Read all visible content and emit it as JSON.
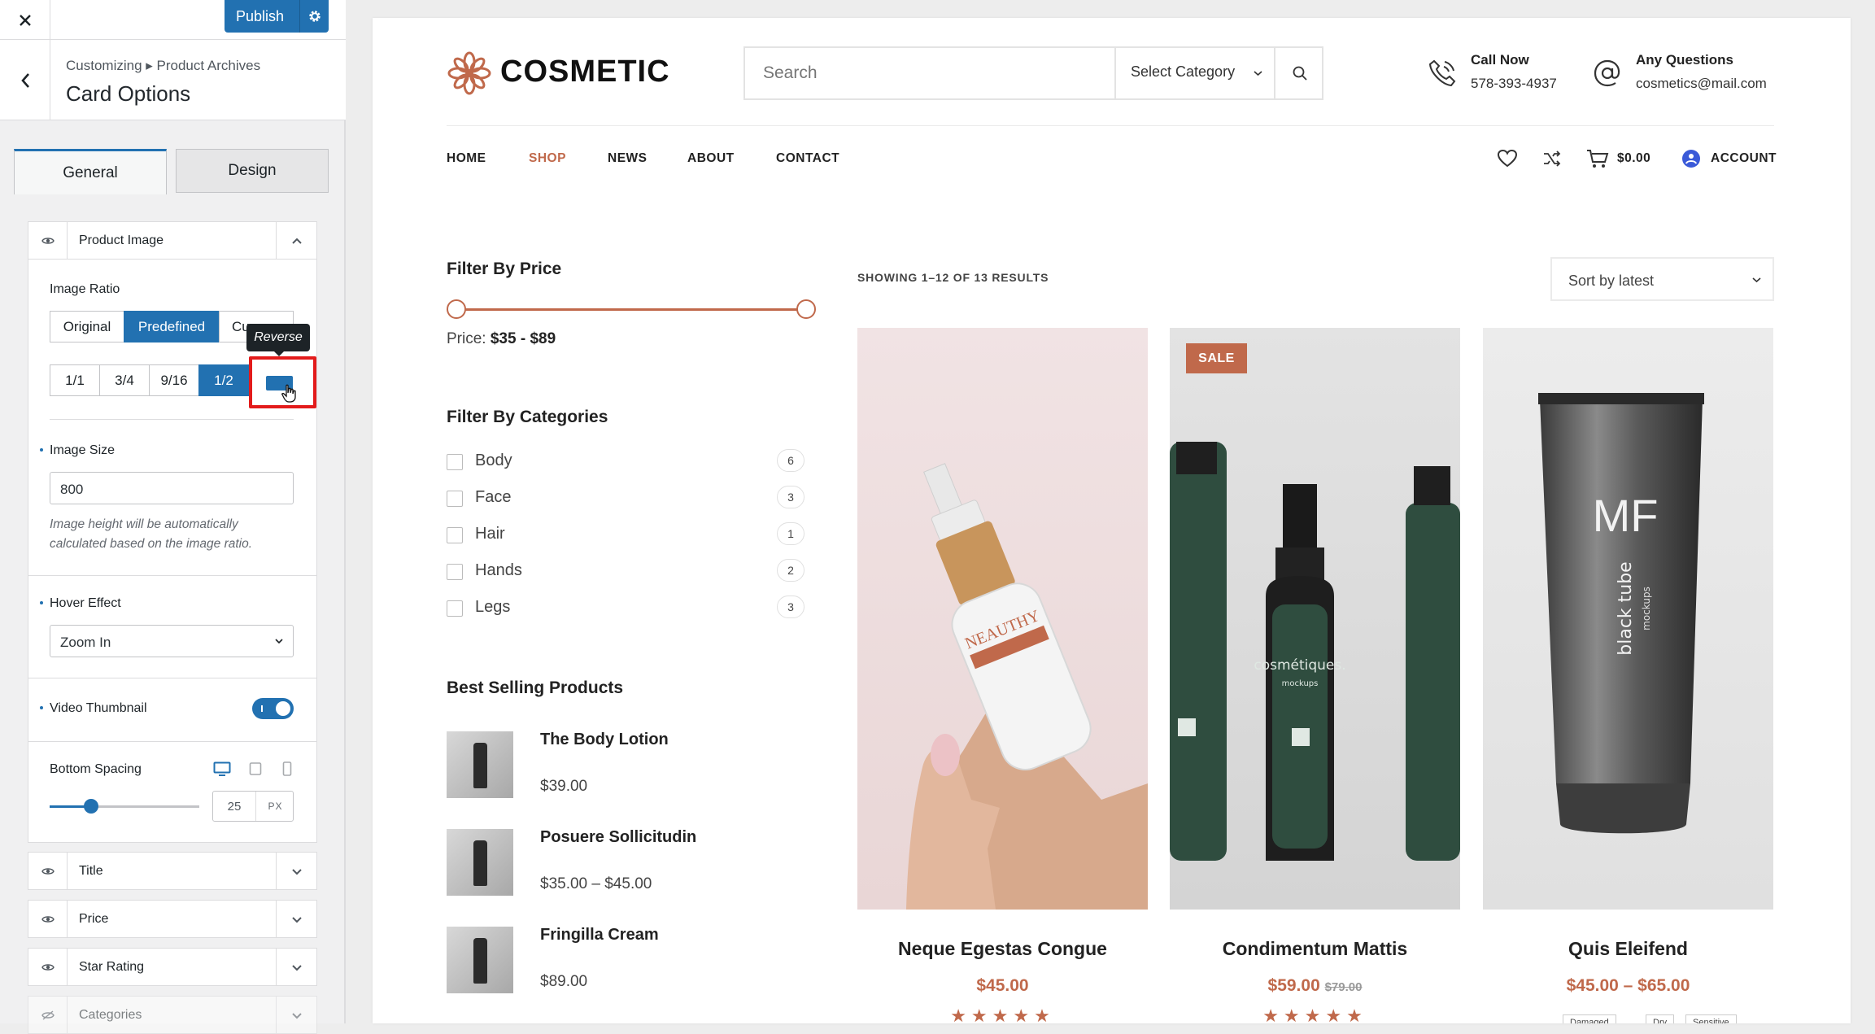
{
  "customizer": {
    "publish_label": "Publish",
    "breadcrumb": "Customizing ▸ Product Archives",
    "title": "Card Options",
    "tabs": [
      {
        "label": "General",
        "active": true
      },
      {
        "label": "Design",
        "active": false
      }
    ],
    "product_image": {
      "header": "Product Image",
      "image_ratio_label": "Image Ratio",
      "ratio_modes": [
        "Original",
        "Predefined",
        "Cu"
      ],
      "active_mode": "Predefined",
      "ratios": [
        "1/1",
        "3/4",
        "9/16",
        "1/2"
      ],
      "active_ratio": "1/2",
      "reverse_tooltip": "Reverse",
      "image_size_label": "Image Size",
      "image_size_value": "800",
      "image_size_hint": "Image height will be automatically calculated based on the image ratio.",
      "hover_effect_label": "Hover Effect",
      "hover_effect_value": "Zoom In",
      "video_thumbnail_label": "Video Thumbnail",
      "video_thumbnail_on": true,
      "bottom_spacing_label": "Bottom Spacing",
      "bottom_spacing_value": "25",
      "bottom_spacing_unit": "PX"
    },
    "sections": [
      "Title",
      "Price",
      "Star Rating",
      "Categories"
    ],
    "accent_color": "#2271b1",
    "highlight_color": "#e31b1b"
  },
  "site": {
    "logo": "COSMETIC",
    "search_placeholder": "Search",
    "category_select": "Select Category",
    "call": {
      "title": "Call Now",
      "value": "578-393-4937"
    },
    "questions": {
      "title": "Any Questions",
      "value": "cosmetics@mail.com"
    },
    "nav": [
      "HOME",
      "SHOP",
      "NEWS",
      "ABOUT",
      "CONTACT"
    ],
    "active_nav": "SHOP",
    "cart_total": "$0.00",
    "account_label": "ACCOUNT",
    "filter_price": {
      "heading": "Filter By Price",
      "label": "Price:",
      "range": "$35 - $89"
    },
    "filter_categories": {
      "heading": "Filter By Categories",
      "items": [
        {
          "name": "Body",
          "count": "6"
        },
        {
          "name": "Face",
          "count": "3"
        },
        {
          "name": "Hair",
          "count": "1"
        },
        {
          "name": "Hands",
          "count": "2"
        },
        {
          "name": "Legs",
          "count": "3"
        }
      ]
    },
    "best_selling": {
      "heading": "Best Selling Products",
      "items": [
        {
          "name": "The Body Lotion",
          "price": "$39.00"
        },
        {
          "name": "Posuere Sollicitudin",
          "price": "$35.00 – $45.00"
        },
        {
          "name": "Fringilla Cream",
          "price": "$89.00"
        }
      ]
    },
    "results_text": "SHOWING 1–12 OF 13 RESULTS",
    "sort_label": "Sort by latest",
    "products": [
      {
        "name": "Neque Egestas Congue",
        "price": "$45.00",
        "old_price": "",
        "stars": "★★★★★"
      },
      {
        "name": "Condimentum Mattis",
        "price": "$59.00",
        "old_price": "$79.00",
        "badge": "SALE",
        "stars": "★★★★★"
      },
      {
        "name": "Quis Eleifend",
        "price": "$45.00 – $65.00",
        "old_price": "",
        "tags": [
          "Damaged",
          "Dry",
          "Sensitive"
        ]
      }
    ],
    "product_image_text": {
      "bottle_brand": "NEAUTHY",
      "green_brand": "cosmétiques.",
      "green_sub": "mockups",
      "tube_logo": "MF",
      "tube_text": "black tube",
      "tube_sub": "mockups"
    },
    "accent_color": "#c0694b"
  }
}
